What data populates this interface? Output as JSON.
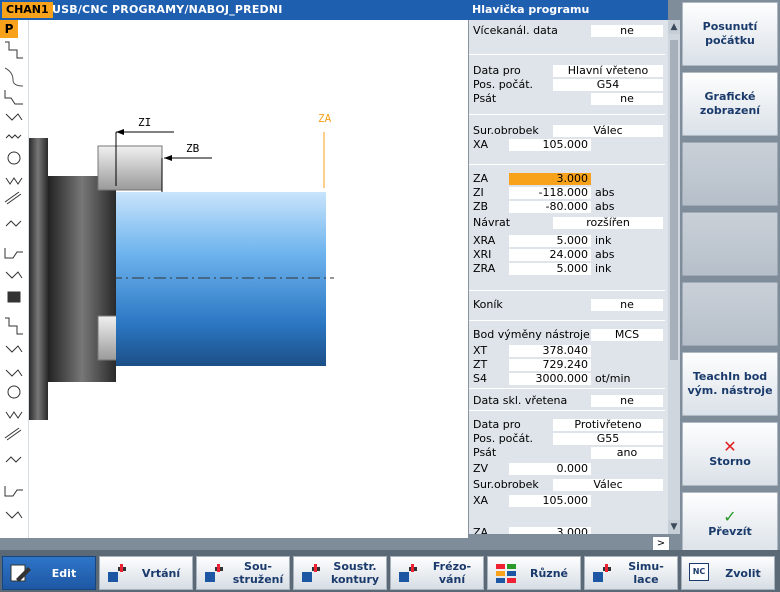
{
  "header": {
    "channel": "CHAN1",
    "path": "USB/CNC PROGRAMY/NABOJ_PREDNI",
    "form_title": "Hlavička programu",
    "mode_marker": "P"
  },
  "graphic": {
    "labels": {
      "zi": "ZI",
      "zb": "ZB",
      "za": "ZA"
    },
    "colors": {
      "workpiece": "#4aa0e6",
      "chuck": "#3a3a3a",
      "za_line": "#f7a21a"
    }
  },
  "form": {
    "rows": [
      {
        "label": "Vícekanál. data",
        "value": "ne",
        "type": "select"
      },
      {
        "label": "Data pro",
        "value": "Hlavní vřeteno",
        "type": "select"
      },
      {
        "label": "Pos. počát.",
        "value": "G54",
        "type": "select"
      },
      {
        "label": "Psát",
        "value": "ne",
        "type": "select"
      },
      {
        "label": "Sur.obrobek",
        "value": "Válec",
        "type": "select"
      },
      {
        "label": "XA",
        "value": "105.000",
        "type": "number"
      },
      {
        "label": "ZA",
        "value": "3.000",
        "type": "number",
        "active": true
      },
      {
        "label": "ZI",
        "value": "-118.000",
        "unit": "abs",
        "type": "number"
      },
      {
        "label": "ZB",
        "value": "-80.000",
        "unit": "abs",
        "type": "number"
      },
      {
        "label": "Návrat",
        "value": "rozšířen",
        "type": "select"
      },
      {
        "label": "XRA",
        "value": "5.000",
        "unit": "ink",
        "type": "number"
      },
      {
        "label": "XRI",
        "value": "24.000",
        "unit": "abs",
        "type": "number"
      },
      {
        "label": "ZRA",
        "value": "5.000",
        "unit": "ink",
        "type": "number"
      },
      {
        "label": "Koník",
        "value": "ne",
        "type": "select"
      },
      {
        "label": "Bod výměny nástroje",
        "value": "MCS",
        "type": "select"
      },
      {
        "label": "XT",
        "value": "378.040",
        "type": "number"
      },
      {
        "label": "ZT",
        "value": "729.240",
        "type": "number"
      },
      {
        "label": "S4",
        "value": "3000.000",
        "unit": "ot/min",
        "type": "number"
      },
      {
        "label": "Data skl. vřetena",
        "value": "ne",
        "type": "select"
      },
      {
        "label": "Data pro",
        "value": "Protivřeteno",
        "type": "select"
      },
      {
        "label": "Pos. počát.",
        "value": "G55",
        "type": "select"
      },
      {
        "label": "Psát",
        "value": "ano",
        "type": "select"
      },
      {
        "label": "ZV",
        "value": "0.000",
        "type": "number"
      },
      {
        "label": "Sur.obrobek",
        "value": "Válec",
        "type": "select"
      },
      {
        "label": "XA",
        "value": "105.000",
        "type": "number"
      },
      {
        "label": "ZA",
        "value": "3.000",
        "type": "number"
      }
    ]
  },
  "softkeys_vertical": [
    {
      "label": "Posunutí počátku"
    },
    {
      "label": "Grafické zobrazení"
    },
    {
      "label": ""
    },
    {
      "label": ""
    },
    {
      "label": ""
    },
    {
      "label": "TeachIn bod vým. nástroje"
    },
    {
      "label": "Storno",
      "icon": "close-icon",
      "symbol": "✕",
      "color": "#e02020"
    },
    {
      "label": "Převzít",
      "icon": "checkmark-icon",
      "symbol": "✓",
      "color": "#2a9a2a"
    }
  ],
  "softkeys_horizontal": [
    {
      "label": "Edit",
      "icon": "edit-icon",
      "active": true
    },
    {
      "label": "Vrtání",
      "icon": "drilling-icon"
    },
    {
      "label": "Sou-stružení",
      "icon": "turning-icon"
    },
    {
      "label": "Soustr. kontury",
      "icon": "contour-turning-icon"
    },
    {
      "label": "Frézo-vání",
      "icon": "milling-icon"
    },
    {
      "label": "Různé",
      "icon": "various-icon"
    },
    {
      "label": "Simu-lace",
      "icon": "simulation-icon"
    },
    {
      "label": "Zvolit",
      "icon": "nc-select-icon",
      "badge": "NC"
    }
  ],
  "scroll": {
    "right_arrow": ">"
  }
}
